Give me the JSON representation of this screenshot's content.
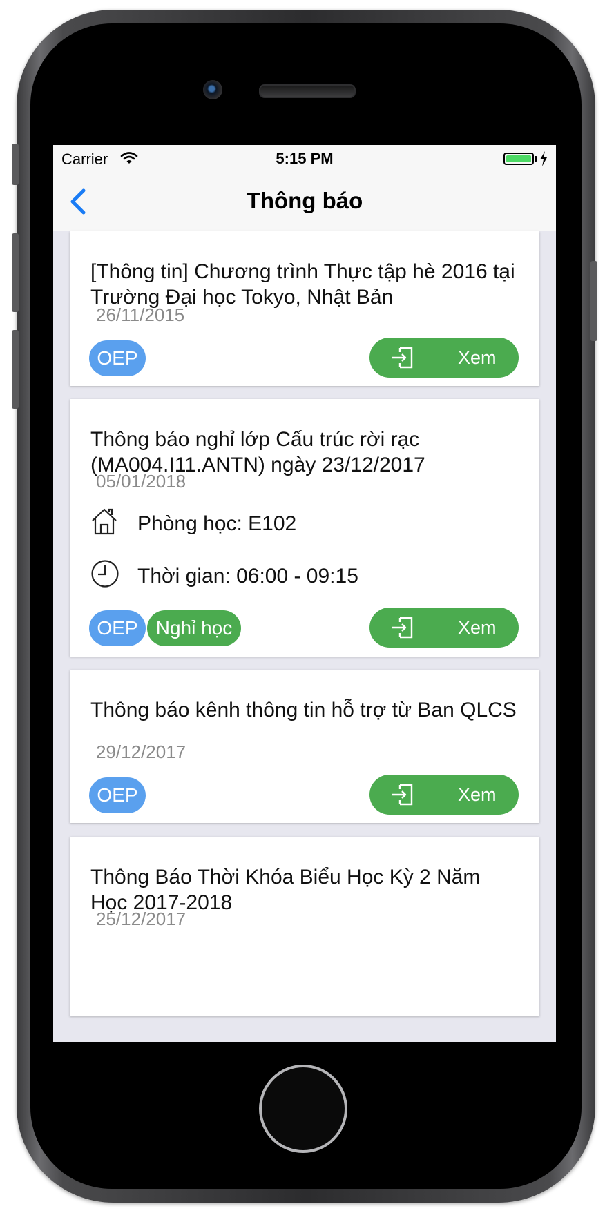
{
  "status_bar": {
    "carrier": "Carrier",
    "time": "5:15 PM"
  },
  "nav": {
    "title": "Thông báo"
  },
  "notifications": [
    {
      "title": "[Thông tin] Chương trình Thực tập hè 2016 tại Trường Đại học Tokyo, Nhật Bản",
      "date": "26/11/2015",
      "tags": [
        "OEP"
      ],
      "action_label": "Xem"
    },
    {
      "title": "Thông báo nghỉ lớp Cấu trúc rời rạc (MA004.I11.ANTN) ngày 23/12/2017",
      "date": "05/01/2018",
      "room": "Phòng học: E102",
      "time": "Thời gian: 06:00 - 09:15",
      "tags": [
        "OEP",
        "Nghỉ học"
      ],
      "action_label": "Xem"
    },
    {
      "title": "Thông báo kênh thông tin hỗ trợ từ Ban QLCS",
      "date": "29/12/2017",
      "tags": [
        "OEP"
      ],
      "action_label": "Xem"
    },
    {
      "title": "Thông Báo Thời Khóa Biểu Học Kỳ 2 Năm Học 2017-2018",
      "date": "25/12/2017"
    }
  ],
  "colors": {
    "tag_blue": "#5aa0ee",
    "tag_green": "#4bab4f",
    "accent": "#1a7cf5",
    "battery": "#4cd964"
  },
  "icons": [
    "back-chevron-icon",
    "wifi-icon",
    "battery-icon",
    "charging-bolt-icon",
    "home-icon",
    "clock-icon",
    "enter-icon"
  ]
}
